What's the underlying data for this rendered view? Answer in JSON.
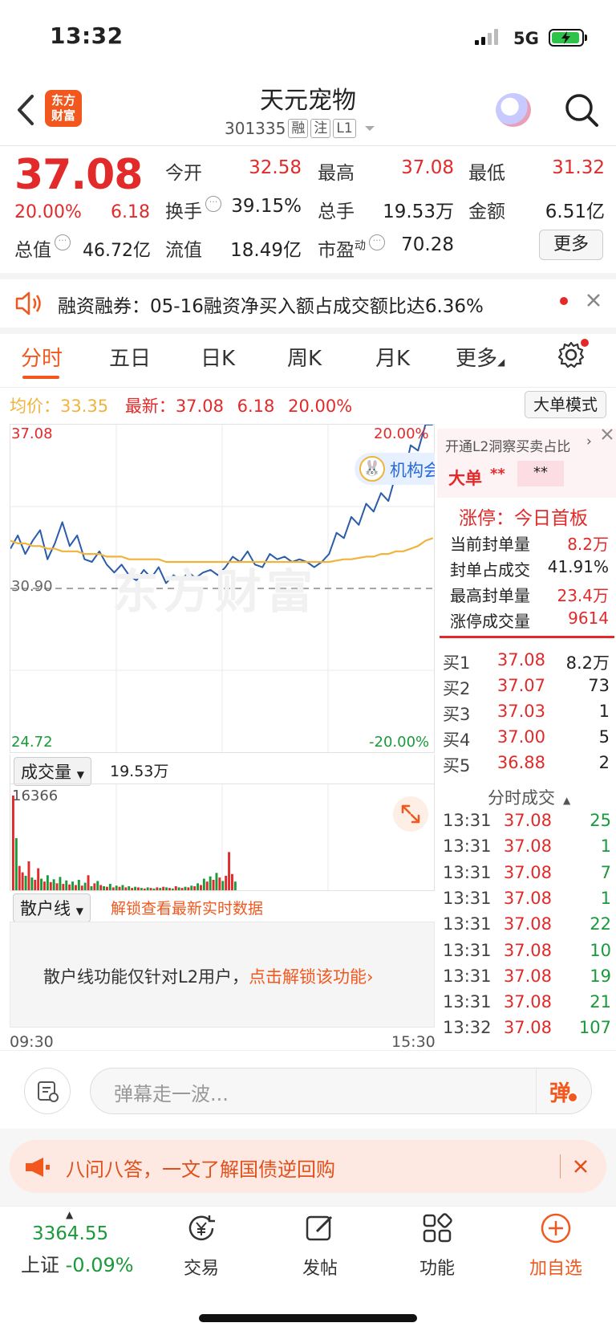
{
  "status_bar": {
    "time": "13:32",
    "network": "5G"
  },
  "header": {
    "logo_text_line1": "东方",
    "logo_text_line2": "财富",
    "stock_name": "天元宠物",
    "stock_code": "301335",
    "tags": [
      "融",
      "注",
      "L1"
    ]
  },
  "quote": {
    "price": "37.08",
    "change_pct": "20.00%",
    "change": "6.18",
    "open_label": "今开",
    "open": "32.58",
    "high_label": "最高",
    "high": "37.08",
    "low_label": "最低",
    "low": "31.32",
    "turnover_rate_label": "换手",
    "turnover_rate": "39.15%",
    "volume_label": "总手",
    "volume": "19.53万",
    "amount_label": "金额",
    "amount": "6.51亿",
    "market_cap_label": "总值",
    "market_cap": "46.72亿",
    "float_cap_label": "流值",
    "float_cap": "18.49亿",
    "pe_label": "市盈",
    "pe_sup": "动",
    "pe": "70.28",
    "more_label": "更多"
  },
  "margin_banner": {
    "text": "融资融券：05-16融资净买入额占成交额比达6.36%"
  },
  "tabs": [
    "分时",
    "五日",
    "日K",
    "周K",
    "月K",
    "更多"
  ],
  "chart_header": {
    "avg_label": "均价：",
    "avg_value": "33.35",
    "latest_label": "最新：",
    "latest_value": "37.08",
    "latest_change": "6.18",
    "latest_pct": "20.00%",
    "big_order_mode": "大单模式"
  },
  "chart_data": {
    "type": "line",
    "y_top": "37.08",
    "y_mid": "30.90",
    "y_bottom": "24.72",
    "pct_top": "20.00%",
    "pct_bottom": "-20.00%",
    "watermark": "东方财富",
    "ylim": [
      24.72,
      37.08
    ],
    "series": [
      {
        "values": [
          32.4,
          32.9,
          32.2,
          32.7,
          33.1,
          32.0,
          32.6,
          33.4,
          32.5,
          32.9,
          32.0,
          31.9,
          32.3,
          31.8,
          31.5,
          31.8,
          31.4,
          31.2,
          31.6,
          31.3,
          31.7,
          31.1,
          31.4,
          31.2,
          31.5,
          31.3,
          31.5,
          31.6,
          31.4,
          31.7,
          32.1,
          31.9,
          32.3,
          31.8,
          31.7,
          32.2,
          32.0,
          32.1,
          31.9,
          32.0,
          31.9,
          31.7,
          31.9,
          32.2,
          33.0,
          32.8,
          33.6,
          33.3,
          34.1,
          33.8,
          34.5,
          34.2,
          35.2,
          35.0,
          36.3,
          36.1,
          37.08,
          37.08
        ]
      },
      {
        "values": [
          32.7,
          32.6,
          32.6,
          32.5,
          32.5,
          32.4,
          32.4,
          32.3,
          32.3,
          32.3,
          32.2,
          32.2,
          32.2,
          32.1,
          32.1,
          32.1,
          32.0,
          32.0,
          32.0,
          32.0,
          32.0,
          31.9,
          31.9,
          31.9,
          31.9,
          31.9,
          31.9,
          31.9,
          31.9,
          31.9,
          31.9,
          31.9,
          31.9,
          31.9,
          31.9,
          31.9,
          31.9,
          31.9,
          31.9,
          31.9,
          31.9,
          31.9,
          31.9,
          31.9,
          31.95,
          32.0,
          32.0,
          32.05,
          32.1,
          32.1,
          32.2,
          32.2,
          32.3,
          32.3,
          32.4,
          32.5,
          32.7,
          32.8
        ]
      }
    ]
  },
  "volume": {
    "dropdown_label": "成交量",
    "total": "19.53万",
    "max_label": "16366",
    "bars": [
      16366,
      9000,
      4200,
      3100,
      2500,
      5000,
      2200,
      1800,
      3800,
      2000,
      1500,
      2600,
      1400,
      1900,
      1200,
      2300,
      1100,
      1700,
      1000,
      1500,
      900,
      1800,
      800,
      1300,
      2600,
      700,
      1200,
      1600,
      900,
      700,
      600,
      1100,
      500,
      800,
      600,
      900,
      500,
      700,
      400,
      600,
      500,
      400,
      300,
      500,
      400,
      300,
      500,
      400,
      600,
      500,
      400,
      300,
      700,
      500,
      400,
      600,
      500,
      800,
      700,
      1200,
      900,
      2000,
      1500,
      2400,
      1800,
      3000,
      2200,
      1600,
      2500,
      6600,
      2800,
      1500
    ],
    "colors": [
      "r",
      "g",
      "r",
      "r",
      "g",
      "r",
      "g",
      "r",
      "r",
      "g",
      "r",
      "g",
      "r",
      "g",
      "r",
      "g",
      "r",
      "g",
      "r",
      "g",
      "r",
      "g",
      "r",
      "g",
      "r",
      "g",
      "r",
      "g",
      "r",
      "g",
      "r",
      "g",
      "r",
      "g",
      "r",
      "g",
      "r",
      "g",
      "r",
      "g",
      "r",
      "g",
      "r",
      "g",
      "r",
      "g",
      "r",
      "g",
      "r",
      "g",
      "r",
      "g",
      "r",
      "g",
      "r",
      "g",
      "r",
      "g",
      "r",
      "g",
      "r",
      "g",
      "r",
      "g",
      "r",
      "g",
      "r",
      "g",
      "r",
      "r",
      "r",
      "g"
    ]
  },
  "retail": {
    "dropdown_label": "散户线",
    "unlock_link": "解锁查看最新实时数据",
    "message": "散户线功能仅针对L2用户，",
    "message_link": "点击解锁该功能"
  },
  "time_axis": {
    "start": "09:30",
    "end": "15:30"
  },
  "right_panel": {
    "promo": "开通L2洞察买卖占比",
    "big_order_label": "大单",
    "masked_a": "**",
    "masked_b": "**",
    "limit_title": "涨停：今日首板",
    "limit_rows": [
      {
        "label": "当前封单量",
        "value": "8.2万"
      },
      {
        "label": "封单占成交",
        "value": "41.91%"
      },
      {
        "label": "最高封单量",
        "value": "23.4万"
      },
      {
        "label": "涨停成交量",
        "value": "9614"
      }
    ],
    "bids": [
      {
        "label": "买1",
        "price": "37.08",
        "vol": "8.2万"
      },
      {
        "label": "买2",
        "price": "37.07",
        "vol": "73"
      },
      {
        "label": "买3",
        "price": "37.03",
        "vol": "1"
      },
      {
        "label": "买4",
        "price": "37.00",
        "vol": "5"
      },
      {
        "label": "买5",
        "price": "36.88",
        "vol": "2"
      }
    ],
    "trades_title": "分时成交",
    "trades": [
      {
        "time": "13:31",
        "price": "37.08",
        "vol": "25"
      },
      {
        "time": "13:31",
        "price": "37.08",
        "vol": "1"
      },
      {
        "time": "13:31",
        "price": "37.08",
        "vol": "7"
      },
      {
        "time": "13:31",
        "price": "37.08",
        "vol": "1"
      },
      {
        "time": "13:31",
        "price": "37.08",
        "vol": "22"
      },
      {
        "time": "13:31",
        "price": "37.08",
        "vol": "10"
      },
      {
        "time": "13:31",
        "price": "37.08",
        "vol": "19"
      },
      {
        "time": "13:31",
        "price": "37.08",
        "vol": "21"
      },
      {
        "time": "13:32",
        "price": "37.08",
        "vol": "107"
      }
    ]
  },
  "comment": {
    "placeholder": "弹幕走一波...",
    "danmu_label": "弹"
  },
  "notice": {
    "text": "八问八答，一文了解国债逆回购"
  },
  "bottom_bar": {
    "index_value": "3364.55",
    "index_name": "上证",
    "index_change": "-0.09%",
    "items": [
      "交易",
      "发帖",
      "功能",
      "加自选"
    ]
  },
  "badge": {
    "text": "机构会"
  },
  "colors": {
    "up": "#e22a2a",
    "down": "#1a9a3a",
    "accent": "#f2581e",
    "price_line": "#2a5caa",
    "avg_line": "#f0b43c"
  }
}
